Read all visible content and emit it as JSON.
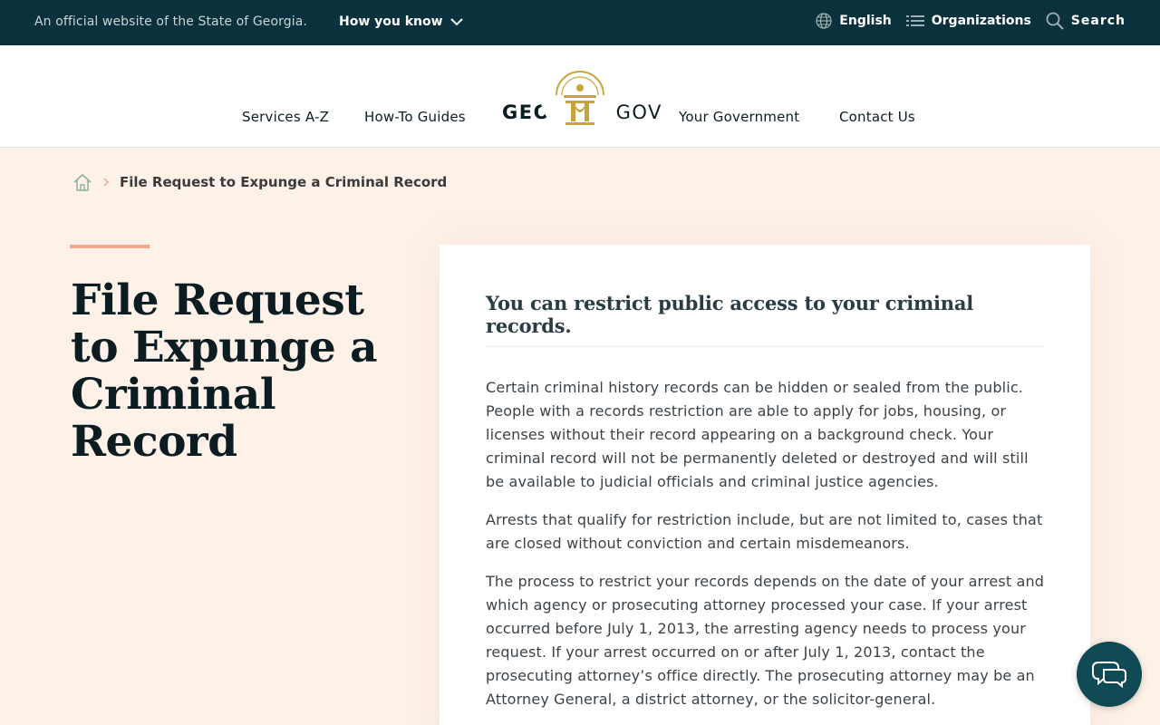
{
  "banner": {
    "official_text": "An official website of the State of Georgia.",
    "how_you_know": "How you know",
    "language": "English",
    "organizations": "Organizations",
    "search": "Search"
  },
  "header": {
    "nav": [
      "Services A-Z",
      "How-To Guides",
      "Your Government",
      "Contact Us"
    ],
    "wordmark_bold": "GEORGIA",
    "wordmark_light": ".GOV"
  },
  "breadcrumb": {
    "current": "File Request to Expunge a Criminal Record"
  },
  "page": {
    "title": "File Request to Expunge a Criminal Record"
  },
  "content": {
    "heading": "You can restrict public access to your criminal records.",
    "paragraphs": [
      "Certain criminal history records can be hidden or sealed from the public. People with a records restriction are able to apply for jobs, housing, or licenses without their record appearing on a background check. Your criminal record will not be permanently deleted or destroyed and will still be available to judicial officials and criminal justice agencies.",
      "Arrests that qualify for restriction include, but are not limited to, cases that are closed without conviction and certain misdemeanors.",
      "The process to restrict your records depends on the date of your arrest and which agency or prosecuting attorney processed your case. If your arrest occurred before July 1, 2013, the arresting agency needs to process your request. If your arrest occurred on or after July 1, 2013, contact the prosecuting attorney’s office directly. The prosecuting attorney may be an Attorney General, a district attorney, or the solicitor-general."
    ]
  },
  "colors": {
    "banner_bg": "#0b323c",
    "page_bg": "#fdf1e8",
    "accent": "#f3a88a",
    "seal_gold": "#c9a33b",
    "chat_bg": "#0f4a55"
  },
  "icons": {
    "how_you_know": "chevron-down-icon",
    "language": "globe-icon",
    "organizations": "list-icon",
    "search": "search-icon",
    "breadcrumb_home": "home-icon",
    "breadcrumb_sep": "chevron-right-icon",
    "chat": "chat-icon",
    "seal": "state-seal-logo"
  }
}
